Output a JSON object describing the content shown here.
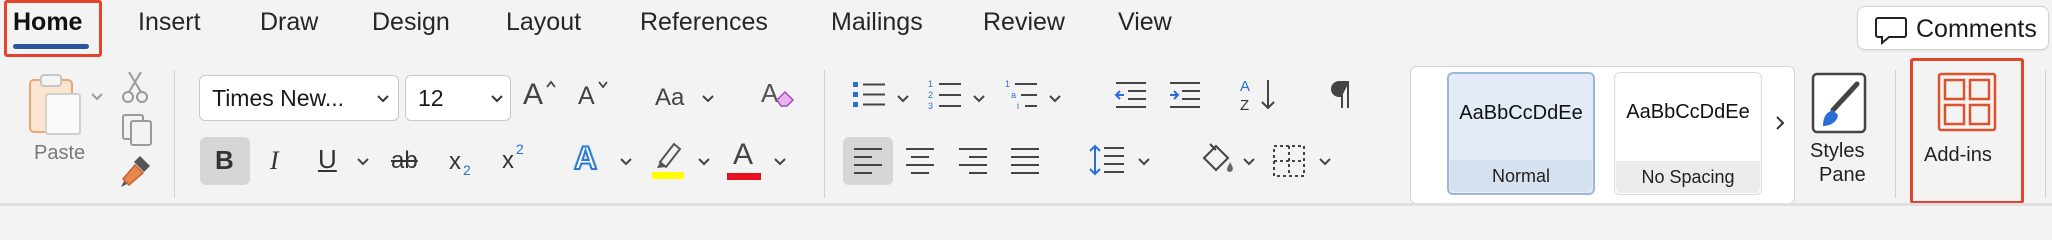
{
  "tabs": [
    {
      "label": "Home",
      "active": true
    },
    {
      "label": "Insert"
    },
    {
      "label": "Draw"
    },
    {
      "label": "Design"
    },
    {
      "label": "Layout"
    },
    {
      "label": "References"
    },
    {
      "label": "Mailings"
    },
    {
      "label": "Review"
    },
    {
      "label": "View"
    }
  ],
  "comments_label": "Comments",
  "clipboard": {
    "paste_label": "Paste"
  },
  "font": {
    "family_value": "Times New...",
    "size_value": "12",
    "change_case_label": "Aa",
    "grow_label": "A",
    "shrink_label": "A",
    "bold_label": "B",
    "italic_label": "I",
    "underline_label": "U",
    "strike_label": "ab",
    "subscript_label": "x",
    "subscript_mark": "2",
    "superscript_label": "x",
    "superscript_mark": "2",
    "text_effects_label": "A",
    "font_color_label": "A"
  },
  "styles": {
    "items": [
      {
        "preview": "AaBbCcDdEe",
        "name": "Normal",
        "selected": true
      },
      {
        "preview": "AaBbCcDdEe",
        "name": "No Spacing"
      }
    ],
    "pane_label_line1": "Styles",
    "pane_label_line2": "Pane"
  },
  "addins_label": "Add-ins",
  "colors": {
    "accent": "#2b579a",
    "highlight_red": "#e2442c",
    "highlight_yellow": "#ffff00",
    "font_color_red": "#e81123",
    "paste_orange": "#e8a774",
    "addins_orange": "#d9532c"
  }
}
